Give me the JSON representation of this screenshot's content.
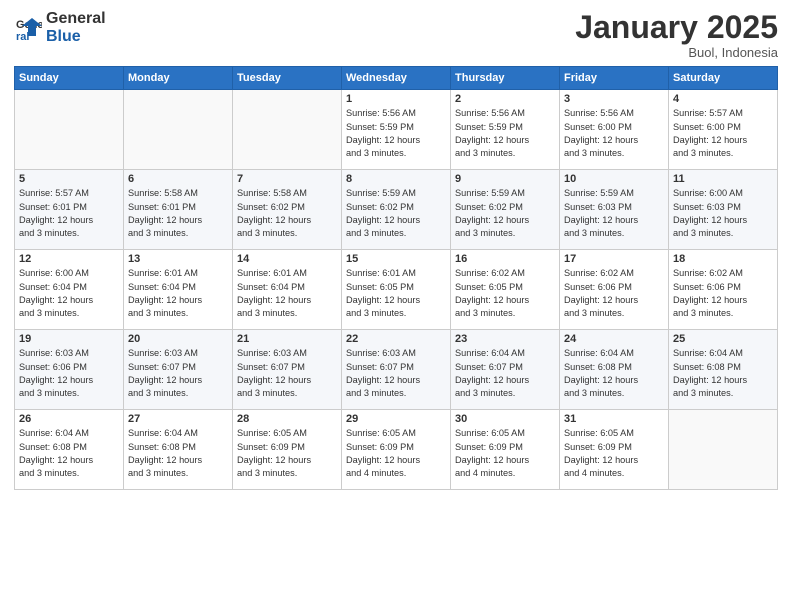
{
  "logo": {
    "line1": "General",
    "line2": "Blue"
  },
  "title": "January 2025",
  "location": "Buol, Indonesia",
  "days_of_week": [
    "Sunday",
    "Monday",
    "Tuesday",
    "Wednesday",
    "Thursday",
    "Friday",
    "Saturday"
  ],
  "weeks": [
    [
      {
        "day": "",
        "info": ""
      },
      {
        "day": "",
        "info": ""
      },
      {
        "day": "",
        "info": ""
      },
      {
        "day": "1",
        "info": "Sunrise: 5:56 AM\nSunset: 5:59 PM\nDaylight: 12 hours\nand 3 minutes."
      },
      {
        "day": "2",
        "info": "Sunrise: 5:56 AM\nSunset: 5:59 PM\nDaylight: 12 hours\nand 3 minutes."
      },
      {
        "day": "3",
        "info": "Sunrise: 5:56 AM\nSunset: 6:00 PM\nDaylight: 12 hours\nand 3 minutes."
      },
      {
        "day": "4",
        "info": "Sunrise: 5:57 AM\nSunset: 6:00 PM\nDaylight: 12 hours\nand 3 minutes."
      }
    ],
    [
      {
        "day": "5",
        "info": "Sunrise: 5:57 AM\nSunset: 6:01 PM\nDaylight: 12 hours\nand 3 minutes."
      },
      {
        "day": "6",
        "info": "Sunrise: 5:58 AM\nSunset: 6:01 PM\nDaylight: 12 hours\nand 3 minutes."
      },
      {
        "day": "7",
        "info": "Sunrise: 5:58 AM\nSunset: 6:02 PM\nDaylight: 12 hours\nand 3 minutes."
      },
      {
        "day": "8",
        "info": "Sunrise: 5:59 AM\nSunset: 6:02 PM\nDaylight: 12 hours\nand 3 minutes."
      },
      {
        "day": "9",
        "info": "Sunrise: 5:59 AM\nSunset: 6:02 PM\nDaylight: 12 hours\nand 3 minutes."
      },
      {
        "day": "10",
        "info": "Sunrise: 5:59 AM\nSunset: 6:03 PM\nDaylight: 12 hours\nand 3 minutes."
      },
      {
        "day": "11",
        "info": "Sunrise: 6:00 AM\nSunset: 6:03 PM\nDaylight: 12 hours\nand 3 minutes."
      }
    ],
    [
      {
        "day": "12",
        "info": "Sunrise: 6:00 AM\nSunset: 6:04 PM\nDaylight: 12 hours\nand 3 minutes."
      },
      {
        "day": "13",
        "info": "Sunrise: 6:01 AM\nSunset: 6:04 PM\nDaylight: 12 hours\nand 3 minutes."
      },
      {
        "day": "14",
        "info": "Sunrise: 6:01 AM\nSunset: 6:04 PM\nDaylight: 12 hours\nand 3 minutes."
      },
      {
        "day": "15",
        "info": "Sunrise: 6:01 AM\nSunset: 6:05 PM\nDaylight: 12 hours\nand 3 minutes."
      },
      {
        "day": "16",
        "info": "Sunrise: 6:02 AM\nSunset: 6:05 PM\nDaylight: 12 hours\nand 3 minutes."
      },
      {
        "day": "17",
        "info": "Sunrise: 6:02 AM\nSunset: 6:06 PM\nDaylight: 12 hours\nand 3 minutes."
      },
      {
        "day": "18",
        "info": "Sunrise: 6:02 AM\nSunset: 6:06 PM\nDaylight: 12 hours\nand 3 minutes."
      }
    ],
    [
      {
        "day": "19",
        "info": "Sunrise: 6:03 AM\nSunset: 6:06 PM\nDaylight: 12 hours\nand 3 minutes."
      },
      {
        "day": "20",
        "info": "Sunrise: 6:03 AM\nSunset: 6:07 PM\nDaylight: 12 hours\nand 3 minutes."
      },
      {
        "day": "21",
        "info": "Sunrise: 6:03 AM\nSunset: 6:07 PM\nDaylight: 12 hours\nand 3 minutes."
      },
      {
        "day": "22",
        "info": "Sunrise: 6:03 AM\nSunset: 6:07 PM\nDaylight: 12 hours\nand 3 minutes."
      },
      {
        "day": "23",
        "info": "Sunrise: 6:04 AM\nSunset: 6:07 PM\nDaylight: 12 hours\nand 3 minutes."
      },
      {
        "day": "24",
        "info": "Sunrise: 6:04 AM\nSunset: 6:08 PM\nDaylight: 12 hours\nand 3 minutes."
      },
      {
        "day": "25",
        "info": "Sunrise: 6:04 AM\nSunset: 6:08 PM\nDaylight: 12 hours\nand 3 minutes."
      }
    ],
    [
      {
        "day": "26",
        "info": "Sunrise: 6:04 AM\nSunset: 6:08 PM\nDaylight: 12 hours\nand 3 minutes."
      },
      {
        "day": "27",
        "info": "Sunrise: 6:04 AM\nSunset: 6:08 PM\nDaylight: 12 hours\nand 3 minutes."
      },
      {
        "day": "28",
        "info": "Sunrise: 6:05 AM\nSunset: 6:09 PM\nDaylight: 12 hours\nand 3 minutes."
      },
      {
        "day": "29",
        "info": "Sunrise: 6:05 AM\nSunset: 6:09 PM\nDaylight: 12 hours\nand 4 minutes."
      },
      {
        "day": "30",
        "info": "Sunrise: 6:05 AM\nSunset: 6:09 PM\nDaylight: 12 hours\nand 4 minutes."
      },
      {
        "day": "31",
        "info": "Sunrise: 6:05 AM\nSunset: 6:09 PM\nDaylight: 12 hours\nand 4 minutes."
      },
      {
        "day": "",
        "info": ""
      }
    ]
  ]
}
